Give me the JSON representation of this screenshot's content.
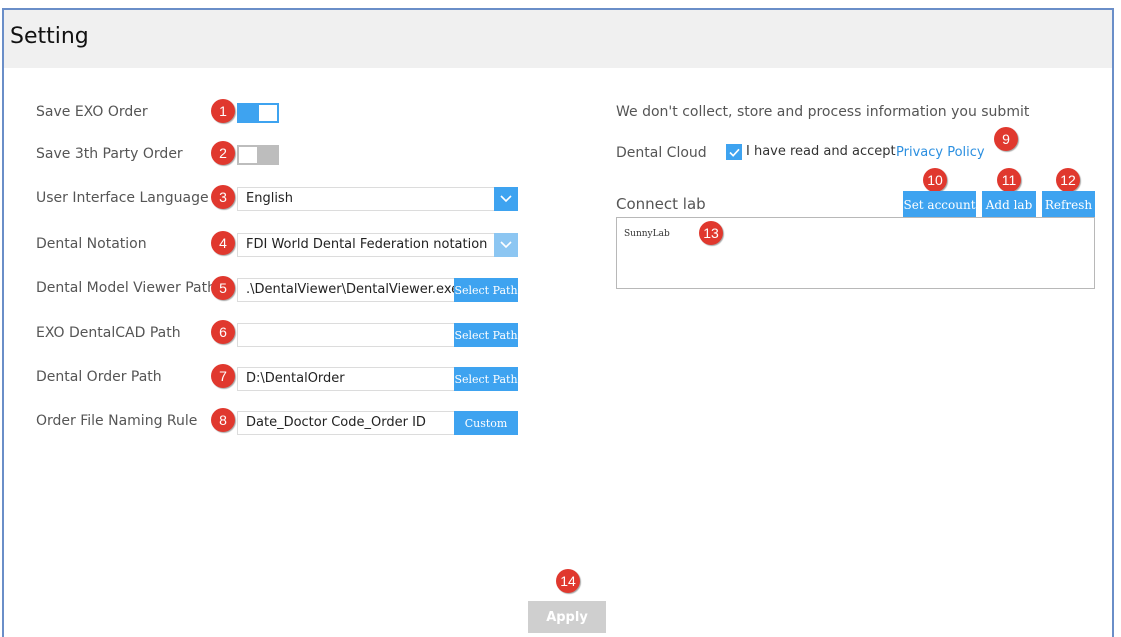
{
  "window": {
    "title": "Setting"
  },
  "settings": {
    "save_exo_order": {
      "label": "Save EXO Order",
      "badge": "1",
      "toggle": "on"
    },
    "save_3th_party_order": {
      "label": "Save 3th Party Order",
      "badge": "2",
      "toggle": "off"
    },
    "ui_language": {
      "label": "User Interface Language",
      "badge": "3",
      "value": "English"
    },
    "dental_notation": {
      "label": "Dental Notation",
      "badge": "4",
      "value": "FDI World Dental Federation notation"
    },
    "viewer_path": {
      "label": "Dental Model Viewer Path",
      "badge": "5",
      "value": ".\\DentalViewer\\DentalViewer.exe",
      "button": "Select Path"
    },
    "exo_cad_path": {
      "label": "EXO DentalCAD Path",
      "badge": "6",
      "value": "",
      "button": "Select Path"
    },
    "order_path": {
      "label": "Dental Order Path",
      "badge": "7",
      "value": "D:\\DentalOrder",
      "button": "Select Path"
    },
    "naming_rule": {
      "label": "Order File Naming Rule",
      "badge": "8",
      "value": "Date_Doctor Code_Order ID",
      "button": "Custom"
    }
  },
  "cloud": {
    "notice": "We don't collect, store and process information you submit",
    "label": "Dental Cloud",
    "accept_text": "I have read and accept",
    "privacy_link": "Privacy Policy",
    "privacy_badge": "9",
    "accepted": true
  },
  "lab": {
    "label": "Connect lab",
    "set_account": "Set account",
    "set_account_badge": "10",
    "add_lab": "Add lab",
    "add_lab_badge": "11",
    "refresh": "Refresh",
    "refresh_badge": "12",
    "items": [
      "SunnyLab"
    ],
    "list_badge": "13"
  },
  "footer": {
    "apply": "Apply",
    "apply_badge": "14"
  },
  "colors": {
    "accent": "#3ea3f0",
    "badge": "#e0382e",
    "disabled": "#cfcfcf",
    "link": "#2b8fe0"
  }
}
